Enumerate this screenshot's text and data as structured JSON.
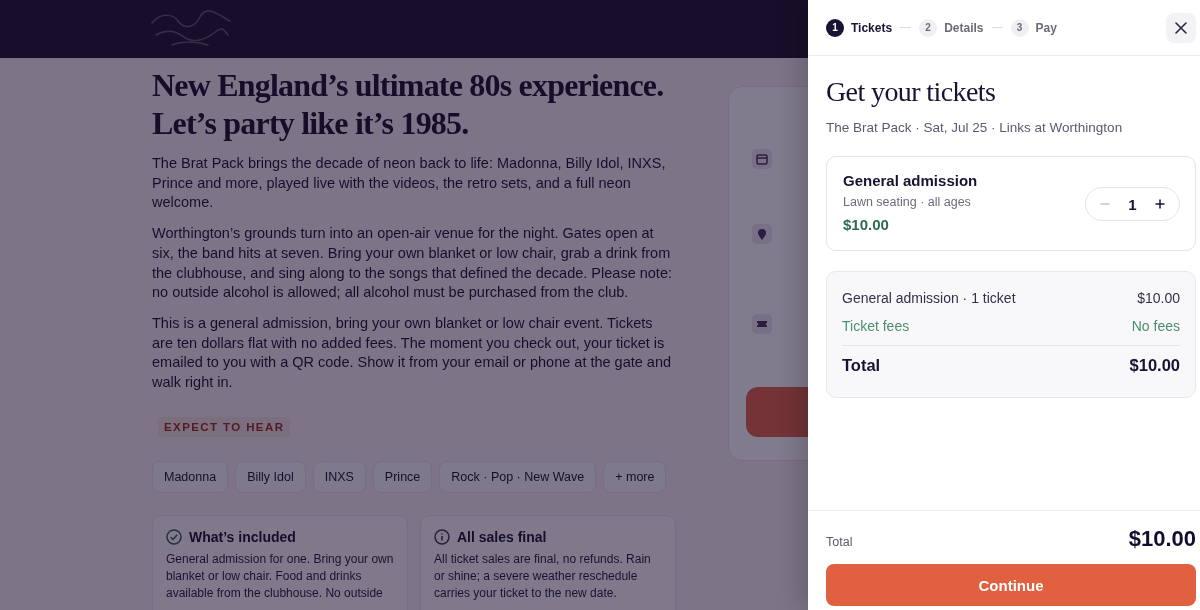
{
  "event_page": {
    "headline": "New England’s ultimate 80s experience. Let’s party like it’s 1985.",
    "paragraphs": [
      "The Brat Pack brings the decade of neon back to life: Madonna, Billy Idol, INXS, Prince and more, played live with the videos, the retro sets, and a full neon welcome.",
      "Worthington’s grounds turn into an open-air venue for the night. Gates open at six, the band hits at seven. Bring your own blanket or low chair, grab a drink from the clubhouse, and sing along to the songs that defined the decade. Please note: no outside alcohol is allowed; all alcohol must be purchased from the club.",
      "This is a general admission, bring your own blanket or low chair event. Tickets are ten dollars flat with no added fees. The moment you check out, your ticket is emailed to you with a QR code. Show it from your email or phone at the gate and walk right in."
    ],
    "section_label": "EXPECT TO HEAR",
    "tags": [
      "Madonna",
      "Billy Idol",
      "INXS",
      "Prince",
      "Rock · Pop · New Wave",
      "+ more"
    ],
    "cards": [
      {
        "kind": "check",
        "title": "What’s included",
        "text": "General admission for one. Bring your own blanket or low chair. Food and drinks available from the clubhouse. No outside"
      },
      {
        "kind": "info",
        "title": "All sales final",
        "text": "All ticket sales are final, no refunds. Rain or shine; a severe weather reschedule carries your ticket to the new date."
      }
    ],
    "sidebar": {
      "items": [
        {
          "kind": "calendar"
        },
        {
          "kind": "pin"
        },
        {
          "kind": "ticket"
        }
      ]
    }
  },
  "checkout": {
    "steps": [
      {
        "number": "1",
        "label": "Tickets",
        "selected": true
      },
      {
        "number": "2",
        "label": "Details",
        "selected": false
      },
      {
        "number": "3",
        "label": "Pay",
        "selected": false
      }
    ],
    "title": "Get your tickets",
    "subtitle": "The Brat Pack · Sat, Jul 25 · Links at Worthington",
    "ticket": {
      "name": "General admission",
      "details": "Lawn seating · all ages",
      "price": "$10.00",
      "quantity": "1",
      "decrease_disabled": true
    },
    "summary": {
      "lines": [
        {
          "kind": "item",
          "label": "General admission · 1 ticket",
          "value": "$10.00"
        },
        {
          "kind": "fee",
          "label": "Ticket fees",
          "value": "No fees"
        }
      ],
      "total_label": "Total",
      "total_value": "$10.00"
    },
    "footer": {
      "total_label": "Total",
      "total_value": "$10.00",
      "button": "Continue"
    }
  }
}
